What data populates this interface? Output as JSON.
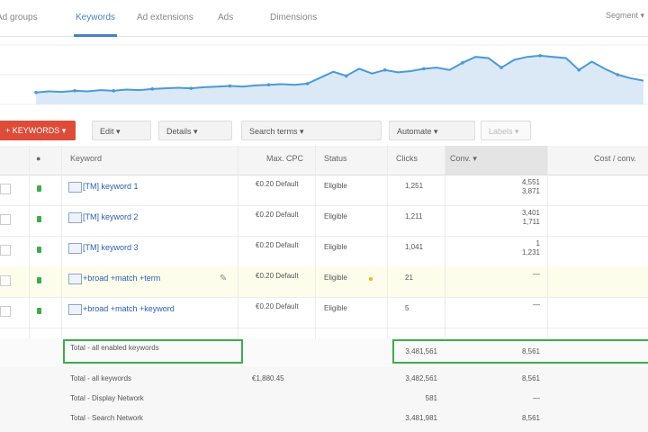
{
  "tabs": [
    {
      "label": "Ad groups"
    },
    {
      "label": "Keywords"
    },
    {
      "label": "Ad extensions"
    },
    {
      "label": "Ads"
    },
    {
      "label": "Dimensions"
    }
  ],
  "top_right": "Segment ▾",
  "toolbar": {
    "add_label": "+ KEYWORDS ▾",
    "edit_label": "Edit ▾",
    "details_label": "Details ▾",
    "search_terms_label": "Search terms ▾",
    "automate_label": "Automate ▾",
    "labels_label": "Labels ▾"
  },
  "table": {
    "headers": [
      "Keyword",
      "Max. CPC",
      "Status",
      "Clicks",
      "Conv. ▾",
      "Cost / conv."
    ],
    "rows": [
      {
        "keyword": "[TM] keyword 1",
        "bid": "€0.20 Default",
        "status": "Eligible",
        "clicks": "1,251",
        "conv": "4,551\n3,871"
      },
      {
        "keyword": "[TM] keyword 2",
        "bid": "€0.20 Default",
        "status": "Eligible",
        "clicks": "1,211",
        "conv": "3,401\n1,711"
      },
      {
        "keyword": "[TM] keyword 3",
        "bid": "€0.20 Default",
        "status": "Eligible",
        "clicks": "1,041",
        "conv": "1\n1,231"
      },
      {
        "keyword": "+broad +match +term",
        "bid": "€0.20 Default",
        "status": "Eligible",
        "clicks": "21",
        "conv": "—"
      },
      {
        "keyword": "+broad +match +keyword",
        "bid": "€0.20 Default",
        "status": "Eligible",
        "clicks": "5",
        "conv": "—"
      }
    ],
    "summary": {
      "label": "Total - all enabled keywords",
      "clicks": "3,481,561",
      "conv": "8,561"
    },
    "totals": [
      {
        "label": "Total - all keywords",
        "v1": "€1,880.45",
        "v2": "3,482,561",
        "v3": "8,561"
      },
      {
        "label": "Total - Display Network",
        "v1": "",
        "v2": "581",
        "v3": "—"
      },
      {
        "label": "Total - Search Network",
        "v1": "",
        "v2": "3,481,981",
        "v3": "8,561"
      }
    ]
  },
  "chart_data": {
    "type": "area",
    "series": [
      {
        "values": [
          20,
          22,
          21,
          23,
          22,
          24,
          23,
          25,
          24,
          26,
          27,
          28,
          27,
          29,
          30,
          31,
          30,
          32,
          33,
          34,
          33,
          35,
          45,
          55,
          48,
          60,
          52,
          58,
          54,
          56,
          60,
          62,
          58,
          70,
          80,
          78,
          62,
          75,
          80,
          82,
          80,
          78,
          58,
          72,
          60,
          50,
          44,
          40
        ]
      }
    ],
    "ylim": [
      0,
      100
    ],
    "grid": true
  }
}
